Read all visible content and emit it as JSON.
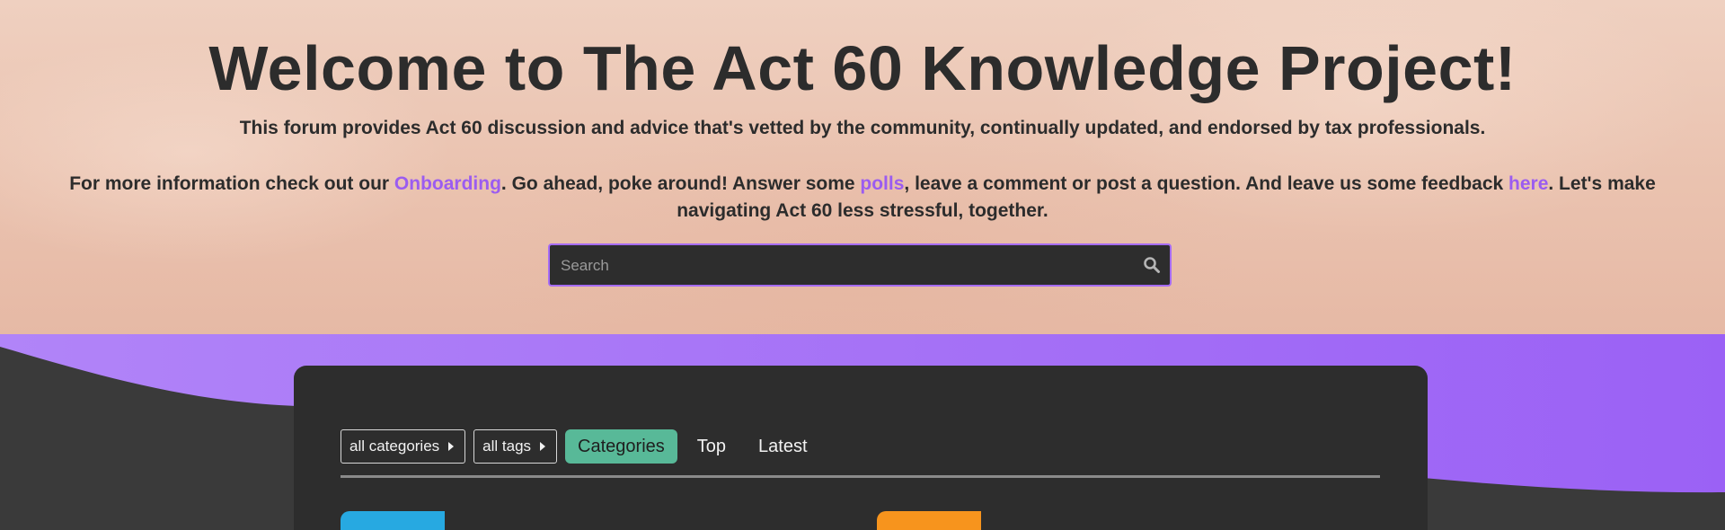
{
  "hero": {
    "title": "Welcome to The Act 60 Knowledge Project!",
    "subtitle": "This forum provides Act 60 discussion and advice that's vetted by the community, continually updated, and endorsed by tax professionals.",
    "info": {
      "part1": "For more information check out our ",
      "onboarding_link": "Onboarding",
      "part2": ". Go ahead, poke around! Answer some ",
      "polls_link": "polls",
      "part3": ", leave a comment or post a question. And leave us some feedback ",
      "here_link": "here",
      "part4": ". Let's make navigating Act 60 less stressful, together."
    },
    "link_color": "#9b5cf0"
  },
  "search": {
    "placeholder": "Search",
    "value": "",
    "icon": "search-icon"
  },
  "nav": {
    "filters": [
      {
        "label": "all categories",
        "icon": "caret-right-icon"
      },
      {
        "label": "all tags",
        "icon": "caret-right-icon"
      }
    ],
    "tabs": [
      {
        "label": "Categories",
        "active": true
      },
      {
        "label": "Top",
        "active": false
      },
      {
        "label": "Latest",
        "active": false
      }
    ]
  },
  "colors": {
    "accent_purple": "#a56bf6",
    "active_tab": "#58b998",
    "panel": "#2d2d2d",
    "category_tile_1": "#27a9e1",
    "category_tile_2": "#f7941d"
  }
}
